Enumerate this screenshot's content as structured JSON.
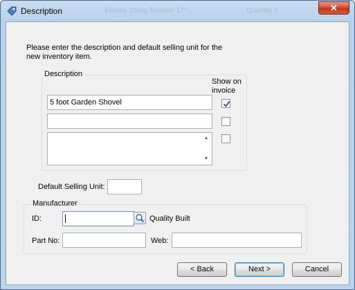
{
  "window": {
    "title": "Description",
    "ghost_titles": [
      "Electric String Trimmer 17\"",
      "Quantity 1"
    ]
  },
  "intro_text": "Please enter the description and default selling unit for the new inventory item.",
  "description_group": {
    "legend": "Description",
    "show_on_invoice": "Show on invoice",
    "line1": {
      "value": "5 foot Garden Shovel",
      "show_checked": true
    },
    "line2": {
      "value": "",
      "show_checked": false
    },
    "line3": {
      "value": "",
      "show_checked": false
    }
  },
  "default_selling_unit": {
    "label": "Default Selling Unit:",
    "value": ""
  },
  "manufacturer_group": {
    "legend": "Manufacturer",
    "id_label": "ID:",
    "id_value": "",
    "name": "Quality Built",
    "part_no_label": "Part No:",
    "part_no_value": "",
    "web_label": "Web:",
    "web_value": ""
  },
  "buttons": {
    "back": "< Back",
    "next": "Next >",
    "cancel": "Cancel"
  },
  "icons": {
    "close": "close-icon",
    "app": "tag-icon",
    "lookup": "magnifier-icon",
    "check": "checkmark-icon"
  }
}
